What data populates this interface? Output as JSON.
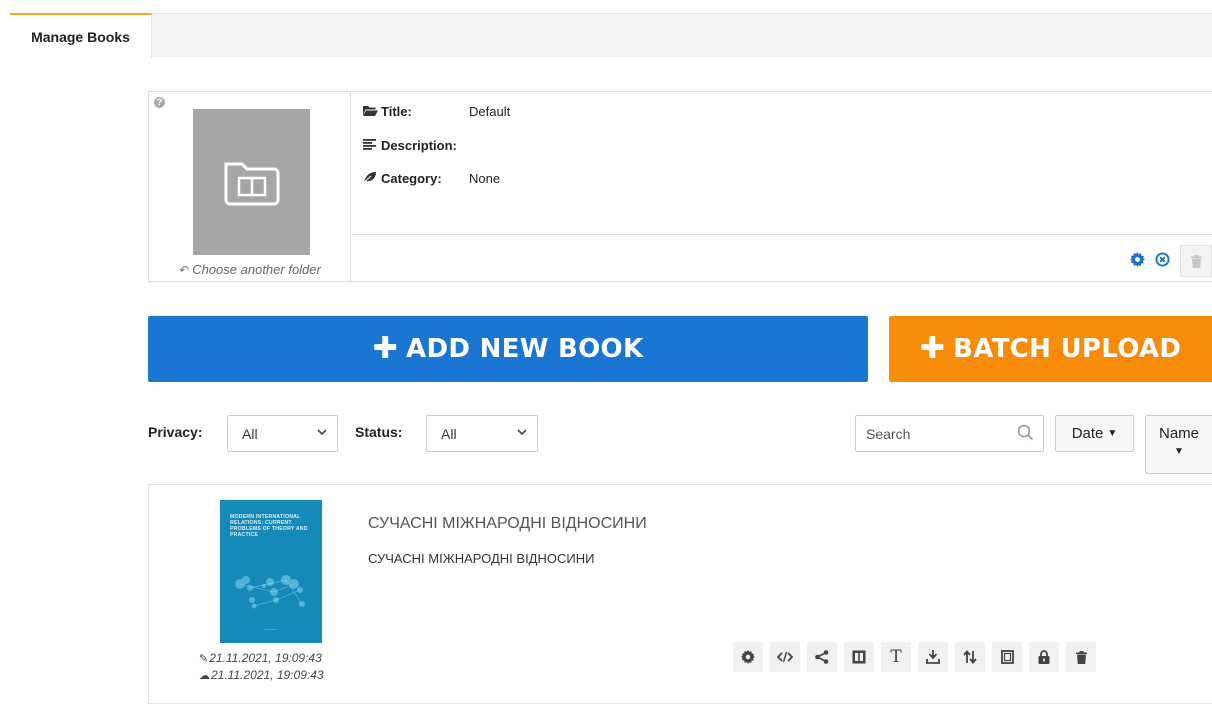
{
  "tabs": {
    "active_label": "Manage Books"
  },
  "folder": {
    "title_label": "Title:",
    "title_value": "Default",
    "description_label": "Description:",
    "description_value": "",
    "category_label": "Category:",
    "category_value": "None",
    "choose_another": "Choose another folder"
  },
  "actions": {
    "add_new_book": "ADD NEW BOOK",
    "batch_upload": "BATCH UPLOAD"
  },
  "filters": {
    "privacy_label": "Privacy:",
    "privacy_value": "All",
    "status_label": "Status:",
    "status_value": "All",
    "search_placeholder": "Search",
    "sort_date": "Date",
    "sort_name": "Name"
  },
  "books": [
    {
      "title": "СУЧАСНІ МІЖНАРОДНІ ВІДНОСИНИ",
      "description": "СУЧАСНІ МІЖНАРОДНІ ВІДНОСИНИ",
      "cover_text": "MODERN INTERNATIONAL RELATIONS: CURRENT PROBLEMS OF THEORY AND PRACTICE",
      "modified": "21.11.2021, 19:09:43",
      "uploaded": "21.11.2021, 19:09:43"
    }
  ],
  "colors": {
    "add_button": "#1976d2",
    "batch_button": "#f78b0a",
    "tab_accent": "#f5a623",
    "cover": "#158ab8",
    "folder_action": "#1a73c4"
  },
  "icons": {
    "folder_actions": [
      "gear-icon",
      "close-circle-icon",
      "trash-icon"
    ],
    "book_tools": [
      "gear-icon",
      "code-icon",
      "share-icon",
      "book-icon",
      "text-icon",
      "download-icon",
      "sort-icon",
      "copy-icon",
      "lock-icon",
      "trash-icon"
    ]
  }
}
